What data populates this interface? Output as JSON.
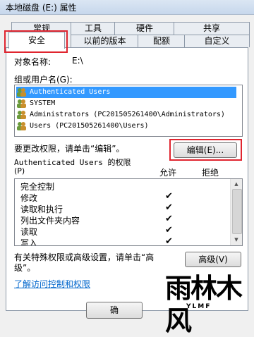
{
  "window": {
    "title": "本地磁盘 (E:) 属性"
  },
  "tabs_row1": [
    "常规",
    "工具",
    "硬件",
    "共享"
  ],
  "tabs_row2": [
    "安全",
    "以前的版本",
    "配额",
    "自定义"
  ],
  "object": {
    "label": "对象名称:",
    "value": "E:\\"
  },
  "group": {
    "label": "组或用户名(G):",
    "items": [
      "Authenticated Users",
      "SYSTEM",
      "Administrators (PC201505261400\\Administrators)",
      "Users (PC201505261400\\Users)"
    ]
  },
  "change_prompt": "要更改权限，请单击“编辑”。",
  "edit_button": "编辑(E)...",
  "permissions": {
    "title_line1": "Authenticated Users 的权限",
    "title_line2": "(P)",
    "allow_header": "允许",
    "deny_header": "拒绝",
    "rows": [
      "完全控制",
      "修改",
      "读取和执行",
      "列出文件夹内容",
      "读取",
      "写入"
    ],
    "allow": [
      false,
      true,
      true,
      true,
      true,
      true
    ]
  },
  "special": {
    "text_line1": "有关特殊权限或高级设置，请单击“高",
    "text_line2": "级”。"
  },
  "advanced_button": "高级(V)",
  "link": "了解访问控制和权限",
  "ok_button": "确",
  "watermark": {
    "text": "雨林木风",
    "small": "YLMF"
  }
}
